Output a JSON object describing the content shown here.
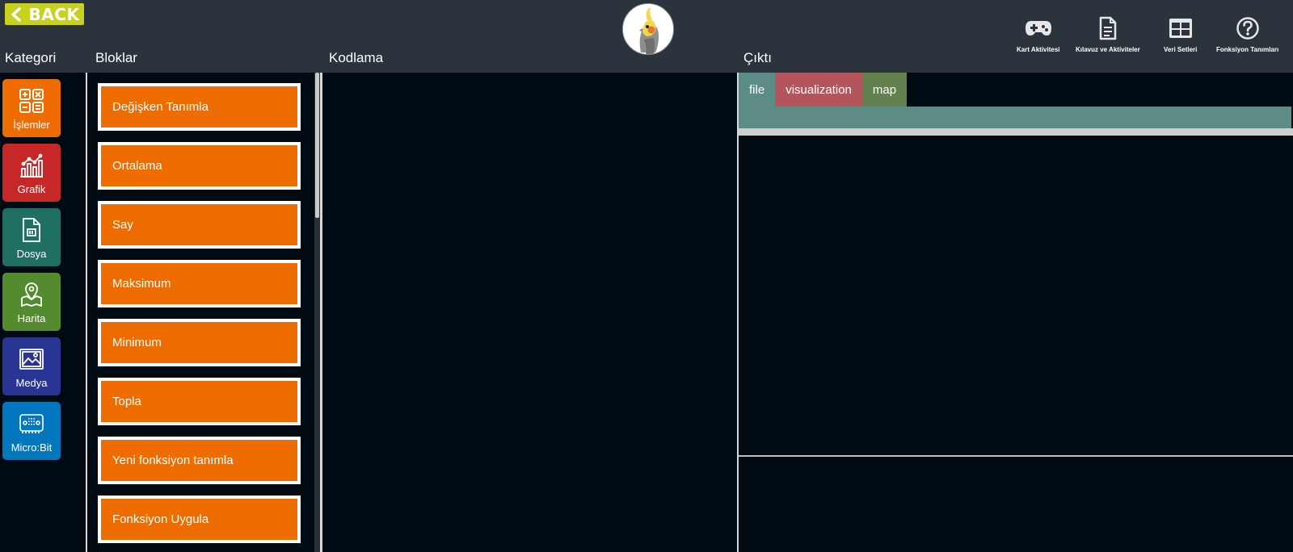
{
  "header": {
    "back_label": "BACK",
    "columns": {
      "kategori": "Kategori",
      "bloklar": "Bloklar",
      "kodlama": "Kodlama",
      "cikti": "Çıktı"
    },
    "tools": [
      {
        "label": "Kart Aktivitesi",
        "icon": "gamepad-icon"
      },
      {
        "label": "Kılavuz ve Aktiviteler",
        "icon": "document-icon"
      },
      {
        "label": "Veri Setleri",
        "icon": "table-icon"
      },
      {
        "label": "Fonksiyon Tanımları",
        "icon": "help-circle-icon"
      }
    ]
  },
  "categories": [
    {
      "label": "İşlemler",
      "icon": "calculator-icon",
      "color": "#ef6c00"
    },
    {
      "label": "Grafik",
      "icon": "chart-icon",
      "color": "#c62828"
    },
    {
      "label": "Dosya",
      "icon": "file-icon",
      "color": "#1f6f63"
    },
    {
      "label": "Harita",
      "icon": "map-pin-icon",
      "color": "#558b2f"
    },
    {
      "label": "Medya",
      "icon": "image-icon",
      "color": "#283593"
    },
    {
      "label": "Micro:Bit",
      "icon": "microbit-icon",
      "color": "#0277bd"
    }
  ],
  "blocks": [
    {
      "label": "Değişken Tanımla"
    },
    {
      "label": "Ortalama"
    },
    {
      "label": "Say"
    },
    {
      "label": "Maksimum"
    },
    {
      "label": "Minimum"
    },
    {
      "label": "Topla"
    },
    {
      "label": "Yeni fonksiyon tanımla"
    },
    {
      "label": "Fonksiyon Uygula"
    }
  ],
  "output": {
    "tabs": [
      {
        "label": "file",
        "color": "#5d8b86"
      },
      {
        "label": "visualization",
        "color": "#b4545b"
      },
      {
        "label": "map",
        "color": "#63804f"
      }
    ]
  },
  "colors": {
    "header_bg": "#2b343d",
    "workspace_bg": "#000a12",
    "block_color": "#ef6c00",
    "back_button": "#c8d11e"
  }
}
